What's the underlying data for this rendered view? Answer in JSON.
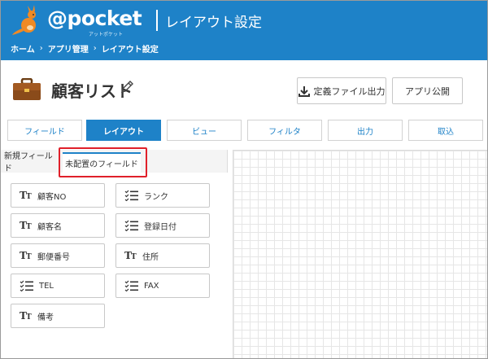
{
  "header": {
    "logo_text": "@pocket",
    "logo_sub": "アットポケット",
    "title": "レイアウト設定",
    "breadcrumb": [
      "ホーム",
      "アプリ管理",
      "レイアウト設定"
    ],
    "breadcrumb_sep": "›"
  },
  "app": {
    "title": "顧客リスト",
    "icon": "briefcase-icon",
    "export_button": "定義ファイル出力",
    "publish_button": "アプリ公開"
  },
  "main_tabs": [
    "フィールド",
    "レイアウト",
    "ビュー",
    "フィルタ",
    "出力",
    "取込"
  ],
  "active_main_tab": "レイアウト",
  "left_panel": {
    "subtabs": [
      "新規フィールド",
      "未配置のフィールド"
    ],
    "active_subtab": "未配置のフィールド",
    "fields": [
      {
        "label": "顧客NO",
        "icon": "text-icon"
      },
      {
        "label": "ランク",
        "icon": "list-icon"
      },
      {
        "label": "顧客名",
        "icon": "text-icon"
      },
      {
        "label": "登録日付",
        "icon": "list-icon"
      },
      {
        "label": "郵便番号",
        "icon": "text-icon"
      },
      {
        "label": "住所",
        "icon": "text-icon"
      },
      {
        "label": "TEL",
        "icon": "list-icon"
      },
      {
        "label": "FAX",
        "icon": "list-icon"
      },
      {
        "label": "備考",
        "icon": "text-icon"
      }
    ]
  },
  "colors": {
    "brand": "#1e82c8",
    "highlight": "#e0202a"
  }
}
